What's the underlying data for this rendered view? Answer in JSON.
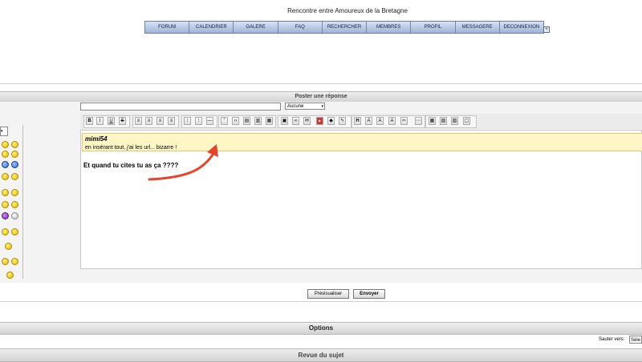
{
  "site": {
    "title": "Rencontre entre Amoureux de la Bretagne"
  },
  "nav": {
    "items": [
      "FORUM",
      "CALENDRIER",
      "GALERE",
      "FAQ",
      "RECHERCHER",
      "MEMBRES",
      "PROFIL",
      "MESSAGERE",
      "DECONNEXION"
    ]
  },
  "reply_section": {
    "title": "Poster une réponse"
  },
  "form": {
    "subject_value": "",
    "icon_select_value": "Aucune"
  },
  "toolbar": {
    "bold": "B",
    "italic": "I",
    "underline": "U",
    "strike": "S",
    "heading": "H"
  },
  "editor": {
    "quote_author": "mimi54",
    "quote_text": "en insérant tout, j'ai les url... bizarre !",
    "reply_text": "Et quand tu cites tu as ça ????"
  },
  "buttons": {
    "preview": "Prévisualiser",
    "send": "Envoyer"
  },
  "options_section": {
    "title": "Options"
  },
  "jump": {
    "label": "Sauter vers:",
    "value": "Séle"
  },
  "review_section": {
    "title": "Revue du sujet"
  },
  "colors": {
    "nav_gradient_top": "#d8e2f2",
    "nav_gradient_bottom": "#9fb4d6",
    "quote_bg": "#fff6c6",
    "arrow": "#e8432b"
  }
}
